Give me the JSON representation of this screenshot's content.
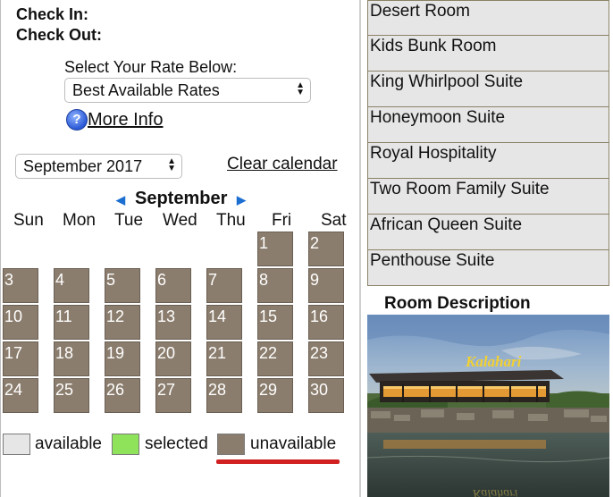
{
  "booking": {
    "check_in_label": "Check In:",
    "check_out_label": "Check Out:",
    "rate_label": "Select Your Rate Below:",
    "rate_selected": "Best Available Rates",
    "more_info": "More Info",
    "month_select": "September 2017",
    "clear_calendar": "Clear calendar"
  },
  "calendar": {
    "month": "September",
    "days_of_week": [
      "Sun",
      "Mon",
      "Tue",
      "Wed",
      "Thu",
      "Fri",
      "Sat"
    ],
    "dates": [
      "1",
      "2",
      "3",
      "4",
      "5",
      "6",
      "7",
      "8",
      "9",
      "10",
      "11",
      "12",
      "13",
      "14",
      "15",
      "16",
      "17",
      "18",
      "19",
      "20",
      "21",
      "22",
      "23",
      "24",
      "25",
      "26",
      "27",
      "28",
      "29",
      "30"
    ],
    "unavailable_color": "#8b7d6d"
  },
  "legend": {
    "available": "available",
    "selected": "selected",
    "unavailable": "unavailable",
    "available_color": "#e6e6e6",
    "selected_color": "#8fe35b",
    "unavailable_color": "#8b7d6d"
  },
  "rooms": [
    {
      "label": "Desert Room"
    },
    {
      "label": "Kids Bunk Room"
    },
    {
      "label": "King Whirlpool Suite"
    },
    {
      "label": "Honeymoon Suite"
    },
    {
      "label": "Royal Hospitality"
    },
    {
      "label": "Two Room Family Suite"
    },
    {
      "label": "African Queen Suite"
    },
    {
      "label": "Penthouse Suite"
    }
  ],
  "room_description": {
    "title": "Room Description",
    "photo_sign": "Kalahari"
  }
}
